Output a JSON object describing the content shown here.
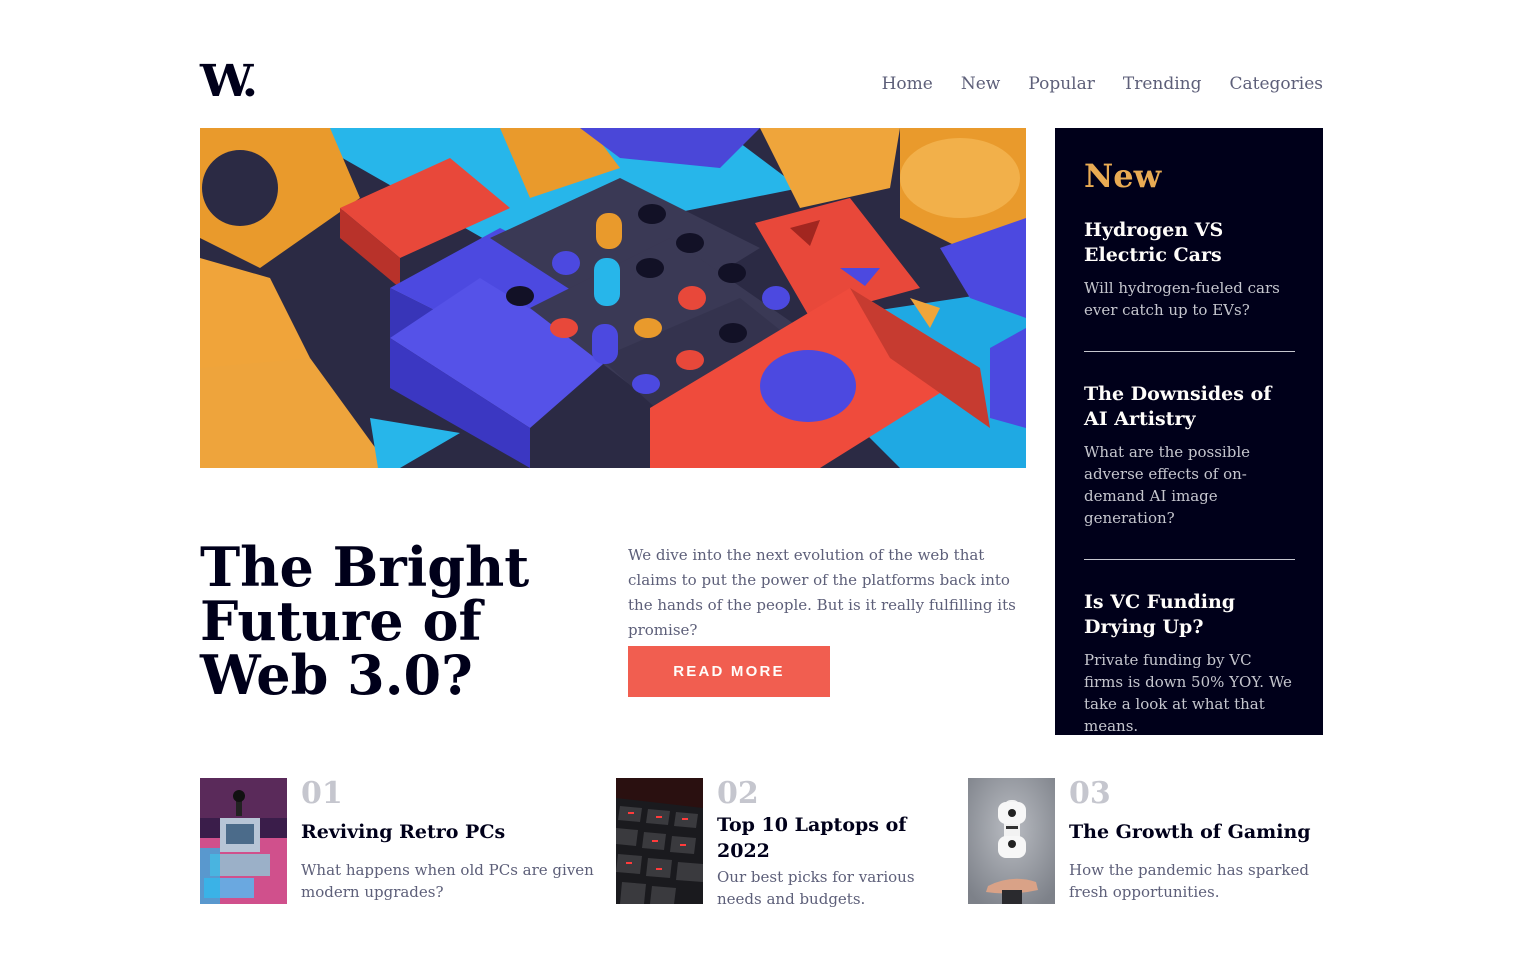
{
  "brand": {
    "logo": "W."
  },
  "nav": {
    "items": [
      {
        "label": "Home"
      },
      {
        "label": "New"
      },
      {
        "label": "Popular"
      },
      {
        "label": "Trending"
      },
      {
        "label": "Categories"
      }
    ]
  },
  "hero": {
    "image_icon": "abstract-3d-blocks-image",
    "title": "The Bright Future of Web 3.0?",
    "description": "We dive into the next evolution of the web that claims to put the power of the platforms back into the hands of the people. But is it really fulfilling its promise?",
    "cta": "READ MORE"
  },
  "new_panel": {
    "heading": "New",
    "items": [
      {
        "title": "Hydrogen VS Electric Cars",
        "description": "Will hydrogen-fueled cars ever catch up to EVs?"
      },
      {
        "title": "The Downsides of AI Artistry",
        "description": "What are the possible adverse effects of on-demand AI image generation?"
      },
      {
        "title": "Is VC Funding Drying Up?",
        "description": "Private funding by VC firms is down 50% YOY. We take a look at what that means."
      }
    ]
  },
  "cards": [
    {
      "number": "01",
      "title": "Reviving Retro PCs",
      "description": "What happens when old PCs are given modern upgrades?",
      "image_icon": "retro-pc-image"
    },
    {
      "number": "02",
      "title": "Top 10 Laptops of 2022",
      "description": "Our best picks for various needs and budgets.",
      "image_icon": "laptop-keyboard-image"
    },
    {
      "number": "03",
      "title": "The Growth of Gaming",
      "description": "How the pandemic has sparked fresh opportunities.",
      "image_icon": "game-controller-image"
    }
  ],
  "colors": {
    "dark_navy": "#00001a",
    "soft_red": "#f15e50",
    "soft_orange": "#e9ab53",
    "grayish_blue": "#c5c6ce",
    "dark_grayish_blue": "#5d5f79",
    "off_white": "#fffdfa"
  }
}
